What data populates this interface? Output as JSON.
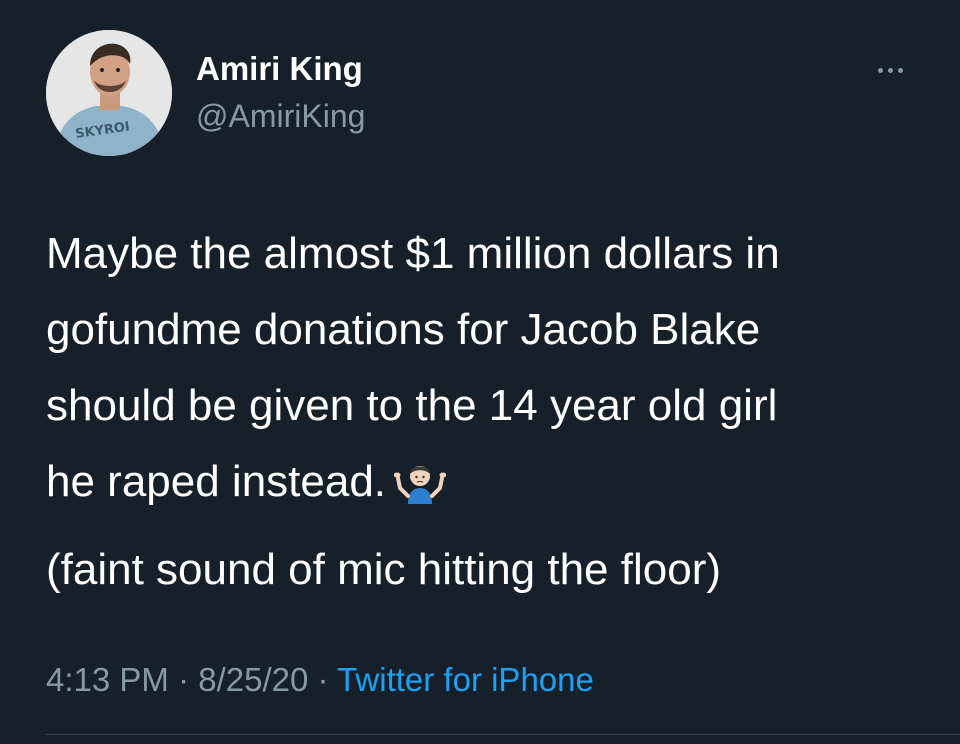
{
  "author": {
    "display_name": "Amiri King",
    "handle": "@AmiriKing",
    "avatar_shirt_text": "SKYROI"
  },
  "tweet": {
    "paragraph_1_line_1": "Maybe the almost $1 million dollars in",
    "paragraph_1_line_2": "gofundme donations for Jacob Blake",
    "paragraph_1_line_3": "should be given to the 14 year old girl",
    "paragraph_1_line_4": "he raped instead.",
    "emoji": "person-shrugging-emoji",
    "paragraph_2": "(faint sound of mic hitting the floor)"
  },
  "meta": {
    "time": "4:13 PM",
    "separator_1": " · ",
    "date": "8/25/20",
    "separator_2": " · ",
    "source": "Twitter for iPhone"
  },
  "icons": {
    "more": "more-options-icon"
  },
  "colors": {
    "background": "#15202b",
    "text": "#ffffff",
    "secondary": "#8899a6",
    "accent": "#1da1f2",
    "divider": "#38444d"
  }
}
